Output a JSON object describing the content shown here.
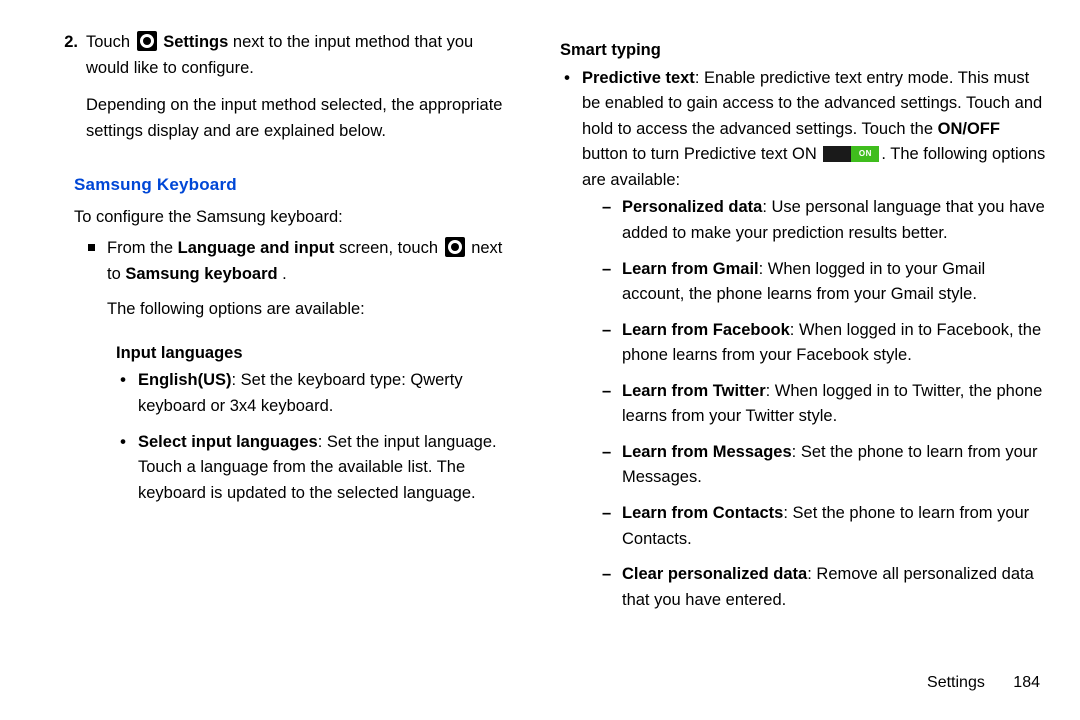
{
  "left": {
    "step2_num": "2.",
    "step2_l1a": "Touch ",
    "step2_l1b": " Settings",
    "step2_l1c": " next to the input method that you would like to configure.",
    "step2_p2": "Depending on the input method selected, the appropriate settings display and are explained below.",
    "heading": "Samsung Keyboard",
    "intro": "To configure the Samsung keyboard:",
    "sq_a1": "From the ",
    "sq_a2": "Language and input",
    "sq_a3": " screen, touch ",
    "sq_a4": " next to ",
    "sq_a5": "Samsung keyboard",
    "sq_a6": ".",
    "sq_p2": "The following options are available:",
    "sub1": "Input languages",
    "b1_bold": "English(US)",
    "b1_rest": ": Set the keyboard type: Qwerty keyboard or 3x4 keyboard.",
    "b2_bold": "Select input languages",
    "b2_rest": ": Set the input language. Touch a language from the available list. The keyboard is updated to the selected language."
  },
  "right": {
    "sub1": "Smart typing",
    "pt_bold": "Predictive text",
    "pt_a": ": Enable predictive text entry mode. This must be enabled to gain access to the advanced settings. Touch and hold to access the advanced settings. Touch the ",
    "pt_onoff": "ON/OFF",
    "pt_b": " button to turn Predictive text ON ",
    "pt_c": ". The following options are available:",
    "toggle_label": "ON",
    "d1_bold": "Personalized data",
    "d1_rest": ": Use personal language that you have added to make your prediction results better.",
    "d2_bold": "Learn from Gmail",
    "d2_rest": ": When logged in to your Gmail account, the phone learns from your Gmail style.",
    "d3_bold": "Learn from Facebook",
    "d3_rest": ": When logged in to Facebook, the phone learns from your Facebook style.",
    "d4_bold": "Learn from Twitter",
    "d4_rest": ": When logged in to Twitter, the phone learns from your Twitter style.",
    "d5_bold": "Learn from Messages",
    "d5_rest": ": Set the phone to learn from your Messages.",
    "d6_bold": "Learn from Contacts",
    "d6_rest": ": Set the phone to learn from your Contacts.",
    "d7_bold": "Clear personalized data",
    "d7_rest": ": Remove all personalized data that you have entered."
  },
  "footer": {
    "section": "Settings",
    "page": "184"
  }
}
